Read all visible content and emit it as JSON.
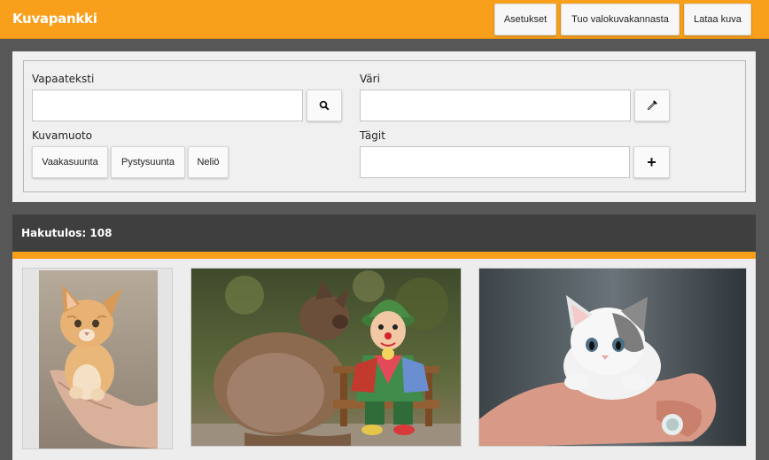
{
  "header": {
    "brand": "Kuvapankki",
    "buttons": [
      "Asetukset",
      "Tuo valokuvakannasta",
      "Lataa kuva"
    ]
  },
  "search": {
    "freetext_label": "Vapaateksti",
    "freetext_value": "",
    "color_label": "Väri",
    "color_value": "",
    "format_label": "Kuvamuoto",
    "formats": [
      "Vaakasuunta",
      "Pystysuunta",
      "Neliö"
    ],
    "tags_label": "Tägit",
    "tags_value": "",
    "add_tag_symbol": "+"
  },
  "results": {
    "label": "Hakutulos: 108"
  },
  "images": [
    {
      "name": "kitten-in-hands"
    },
    {
      "name": "cat-and-clown-doll"
    },
    {
      "name": "white-kitten-on-hand"
    }
  ],
  "colors": {
    "accent": "#f8a01c",
    "dark_bar": "#3f3f3f",
    "page_bg": "#575757"
  }
}
